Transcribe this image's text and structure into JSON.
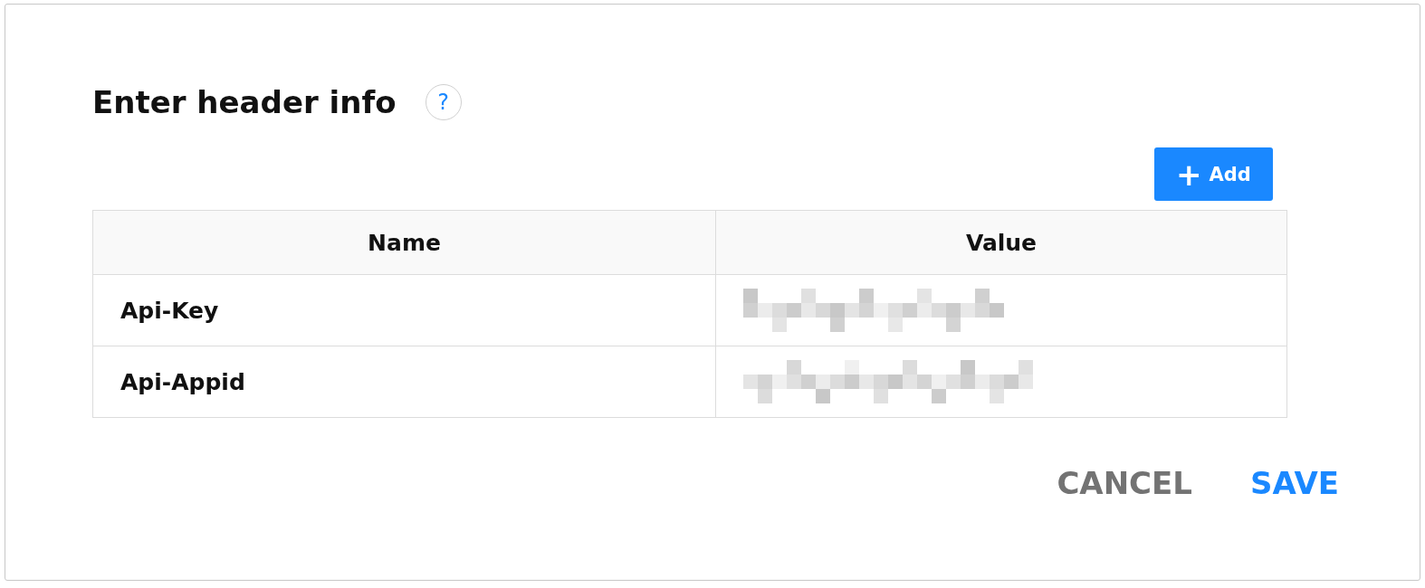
{
  "dialog": {
    "title": "Enter header info",
    "help": "?"
  },
  "add_button": {
    "icon": "+",
    "label": "Add"
  },
  "table": {
    "columns": [
      "Name",
      "Value"
    ],
    "rows": [
      {
        "name": "Api-Key",
        "value": {
          "kind": "redacted"
        }
      },
      {
        "name": "Api-Appid",
        "value": {
          "kind": "redacted"
        }
      }
    ]
  },
  "actions": [
    {
      "label": "CANCEL",
      "kind": "secondary"
    },
    {
      "label": "SAVE",
      "kind": "primary"
    }
  ]
}
